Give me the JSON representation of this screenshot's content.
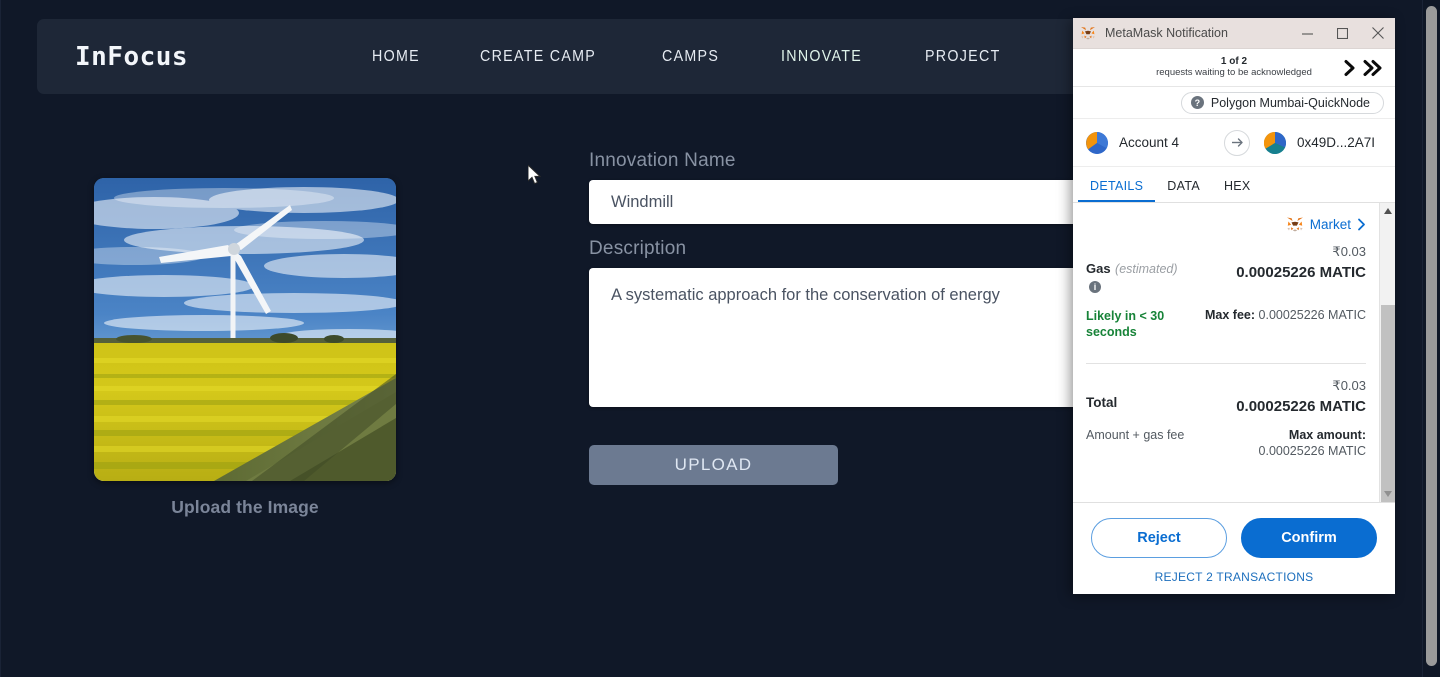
{
  "app": {
    "brand": "InFocus",
    "nav": [
      {
        "label": "HOME",
        "active": false
      },
      {
        "label": "CREATE CAMP",
        "active": false
      },
      {
        "label": "CAMPS",
        "active": false
      },
      {
        "label": "INNOVATE",
        "active": true
      },
      {
        "label": "PROJECT",
        "active": false
      }
    ]
  },
  "upload": {
    "caption": "Upload the Image",
    "image_alt": "wind turbine in yellow canola field under blue sky"
  },
  "form": {
    "name_label": "Innovation Name",
    "name_value": "Windmill",
    "name_placeholder": "Innovation Name",
    "description_label": "Description",
    "description_value": "A systematic approach for the conservation of energy",
    "description_placeholder": "Description",
    "upload_button": "UPLOAD"
  },
  "metamask": {
    "window_title": "MetaMask Notification",
    "window_controls": {
      "minimize": "minimize",
      "maximize": "maximize",
      "close": "close"
    },
    "requests": {
      "count_label": "1 of 2",
      "subtext": "requests waiting to be acknowledged",
      "next": "next-request",
      "skip_all": "skip-all-requests"
    },
    "network": {
      "name": "Polygon Mumbai-QuickNode",
      "badge": "?"
    },
    "accounts": {
      "from": "Account 4",
      "to": "0x49D...2A7I"
    },
    "tabs": [
      {
        "label": "DETAILS",
        "active": true
      },
      {
        "label": "DATA",
        "active": false
      },
      {
        "label": "HEX",
        "active": false
      }
    ],
    "market": {
      "label": "Market",
      "chevron": "›"
    },
    "gas": {
      "label": "Gas",
      "estimated": "(estimated)",
      "info": "i",
      "fiat": "₹0.03",
      "crypto": "0.00025226 MATIC",
      "speed": "Likely in < 30 seconds",
      "max_fee_label": "Max fee:",
      "max_fee_value": "0.00025226 MATIC"
    },
    "total": {
      "label": "Total",
      "fiat": "₹0.03",
      "crypto": "0.00025226 MATIC",
      "sublabel": "Amount + gas fee",
      "max_amount_label": "Max amount:",
      "max_amount_value": "0.00025226 MATIC"
    },
    "footer": {
      "reject": "Reject",
      "confirm": "Confirm",
      "reject_all": "REJECT 2 TRANSACTIONS"
    }
  },
  "colors": {
    "page_bg": "#101828",
    "navbar_bg": "#1e2737",
    "accent_blue": "#0a6dd1",
    "green": "#178338",
    "upload_btn": "#6c7a91"
  }
}
